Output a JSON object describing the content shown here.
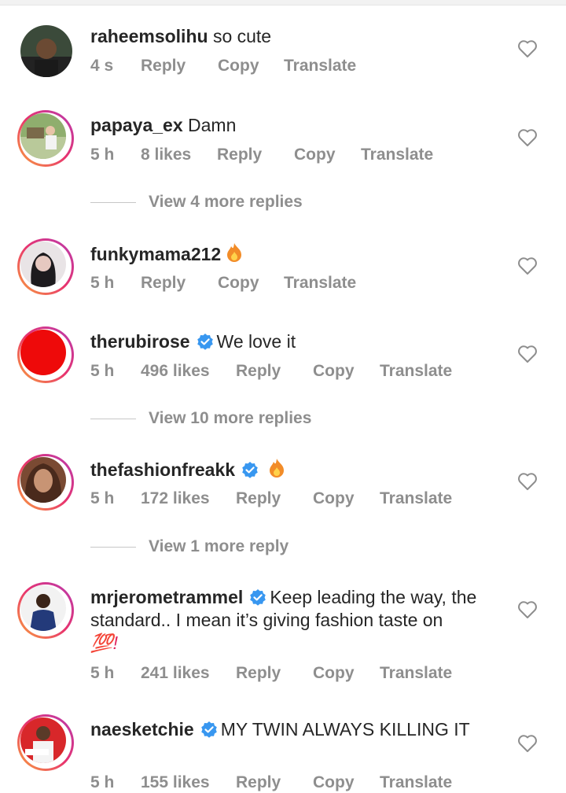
{
  "comments": [
    {
      "username": "raheemsolihu",
      "text": "so cute",
      "time": "4 s",
      "likes": "",
      "reply": "Reply",
      "copy": "Copy",
      "translate": "Translate",
      "verified": false
    },
    {
      "username": "papaya_ex",
      "text": "Damn",
      "time": "5 h",
      "likes": "8 likes",
      "reply": "Reply",
      "copy": "Copy",
      "translate": "Translate",
      "verified": false,
      "view_replies": "View 4 more replies"
    },
    {
      "username": "funkymama212",
      "text": "",
      "emoji": "fire",
      "time": "5 h",
      "likes": "",
      "reply": "Reply",
      "copy": "Copy",
      "translate": "Translate",
      "verified": false
    },
    {
      "username": "therubirose",
      "text": "We love it",
      "time": "5 h",
      "likes": "496 likes",
      "reply": "Reply",
      "copy": "Copy",
      "translate": "Translate",
      "verified": true,
      "view_replies": "View 10 more replies"
    },
    {
      "username": "thefashionfreakk",
      "text": "",
      "emoji": "fire",
      "time": "5 h",
      "likes": "172 likes",
      "reply": "Reply",
      "copy": "Copy",
      "translate": "Translate",
      "verified": true,
      "view_replies": "View 1 more reply"
    },
    {
      "username": "mrjerometrammel",
      "text_line1": "Keep leading the way, the",
      "text_line2": "standard.. I mean it’s giving fashion taste on",
      "text_line3": "💯!",
      "time": "5 h",
      "likes": "241 likes",
      "reply": "Reply",
      "copy": "Copy",
      "translate": "Translate",
      "verified": true
    },
    {
      "username": "naesketchie",
      "text": "MY TWIN ALWAYS KILLING IT",
      "time": "5 h",
      "likes": "155 likes",
      "reply": "Reply",
      "copy": "Copy",
      "translate": "Translate",
      "verified": true
    }
  ],
  "icons": {
    "heart": "heart-outline-icon",
    "verified": "verified-badge-icon",
    "fire": "fire-emoji"
  },
  "colors": {
    "verified": "#3897f0",
    "meta": "#8e8e8e",
    "text": "#262626",
    "story_ring_start": "#f9a33c",
    "story_ring_end": "#b83bb0"
  }
}
